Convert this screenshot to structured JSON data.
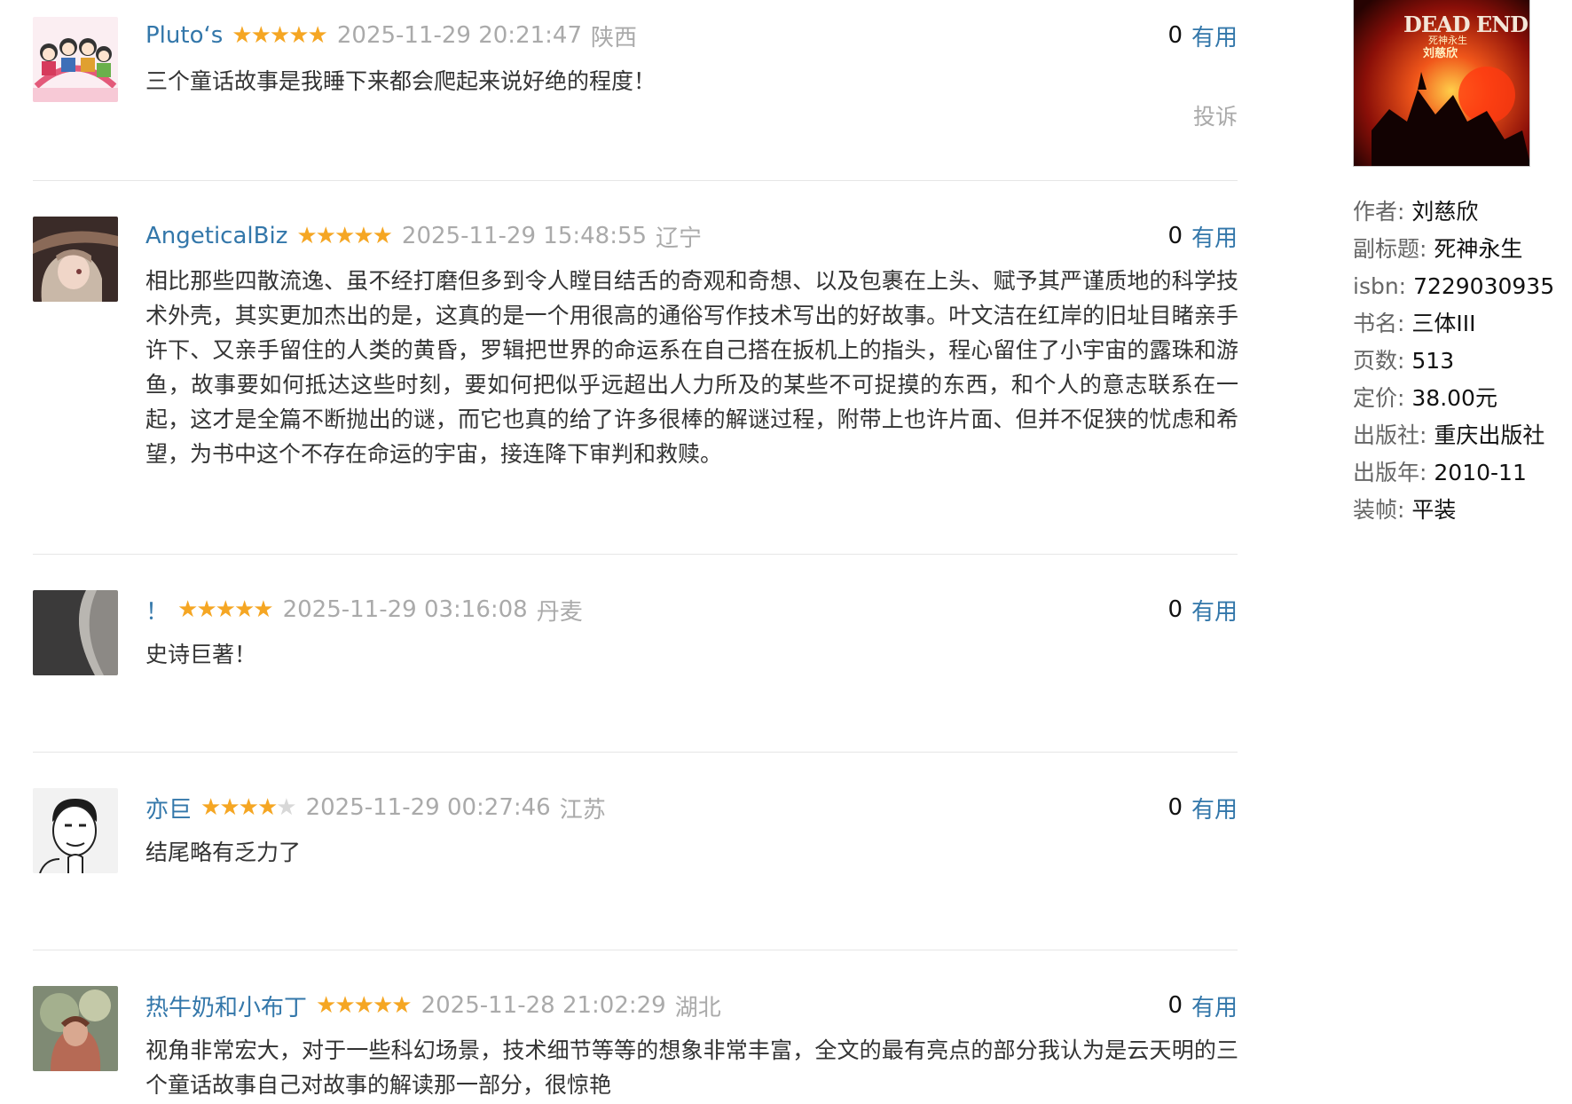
{
  "reviews": [
    {
      "user": "Pluto‘s",
      "rating": 5,
      "time": "2025-11-29 20:21:47",
      "location": "陕西",
      "useful_count": "0",
      "useful_label": "有用",
      "content": "三个童话故事是我睡下来都会爬起来说好绝的程度！",
      "report": "投诉"
    },
    {
      "user": "AngeticalBiz",
      "rating": 5,
      "time": "2025-11-29 15:48:55",
      "location": "辽宁",
      "useful_count": "0",
      "useful_label": "有用",
      "content": "相比那些四散流逸、虽不经打磨但多到令人瞠目结舌的奇观和奇想、以及包裹在上头、赋予其严谨质地的科学技术外壳，其实更加杰出的是，这真的是一个用很高的通俗写作技术写出的好故事。叶文洁在红岸的旧址目睹亲手许下、又亲手留住的人类的黄昏，罗辑把世界的命运系在自己搭在扳机上的指头，程心留住了小宇宙的露珠和游鱼，故事要如何抵达这些时刻，要如何把似乎远超出人力所及的某些不可捉摸的东西，和个人的意志联系在一起，这才是全篇不断抛出的谜，而它也真的给了许多很棒的解谜过程，附带上也许片面、但并不促狭的忧虑和希望，为书中这个不存在命运的宇宙，接连降下审判和救赎。"
    },
    {
      "user": "！",
      "rating": 5,
      "time": "2025-11-29 03:16:08",
      "location": "丹麦",
      "useful_count": "0",
      "useful_label": "有用",
      "content": "史诗巨著！"
    },
    {
      "user": "亦巨",
      "rating": 4,
      "time": "2025-11-29 00:27:46",
      "location": "江苏",
      "useful_count": "0",
      "useful_label": "有用",
      "content": "结尾略有乏力了"
    },
    {
      "user": "热牛奶和小布丁",
      "rating": 5,
      "time": "2025-11-28 21:02:29",
      "location": "湖北",
      "useful_count": "0",
      "useful_label": "有用",
      "content": "视角非常宏大，对于一些科幻场景，技术细节等等的想象非常丰富，全文的最有亮点的部分我认为是云天明的三个童话故事自己对故事的解读那一部分，很惊艳"
    }
  ],
  "book": {
    "cover_text_en": "DEAD END",
    "cover_text_zh": "死神永生",
    "cover_author": "刘慈欣",
    "info": [
      {
        "label": "作者:",
        "value": "刘慈欣"
      },
      {
        "label": "副标题:",
        "value": "死神永生"
      },
      {
        "label": "isbn:",
        "value": "7229030935"
      },
      {
        "label": "书名:",
        "value": "三体III"
      },
      {
        "label": "页数:",
        "value": "513"
      },
      {
        "label": "定价:",
        "value": "38.00元"
      },
      {
        "label": "出版社:",
        "value": "重庆出版社"
      },
      {
        "label": "出版年:",
        "value": "2010-11"
      },
      {
        "label": "装帧:",
        "value": "平装"
      }
    ]
  },
  "colors": {
    "link": "#3377aa",
    "star": "#f5a623",
    "muted": "#aaaaaa"
  }
}
